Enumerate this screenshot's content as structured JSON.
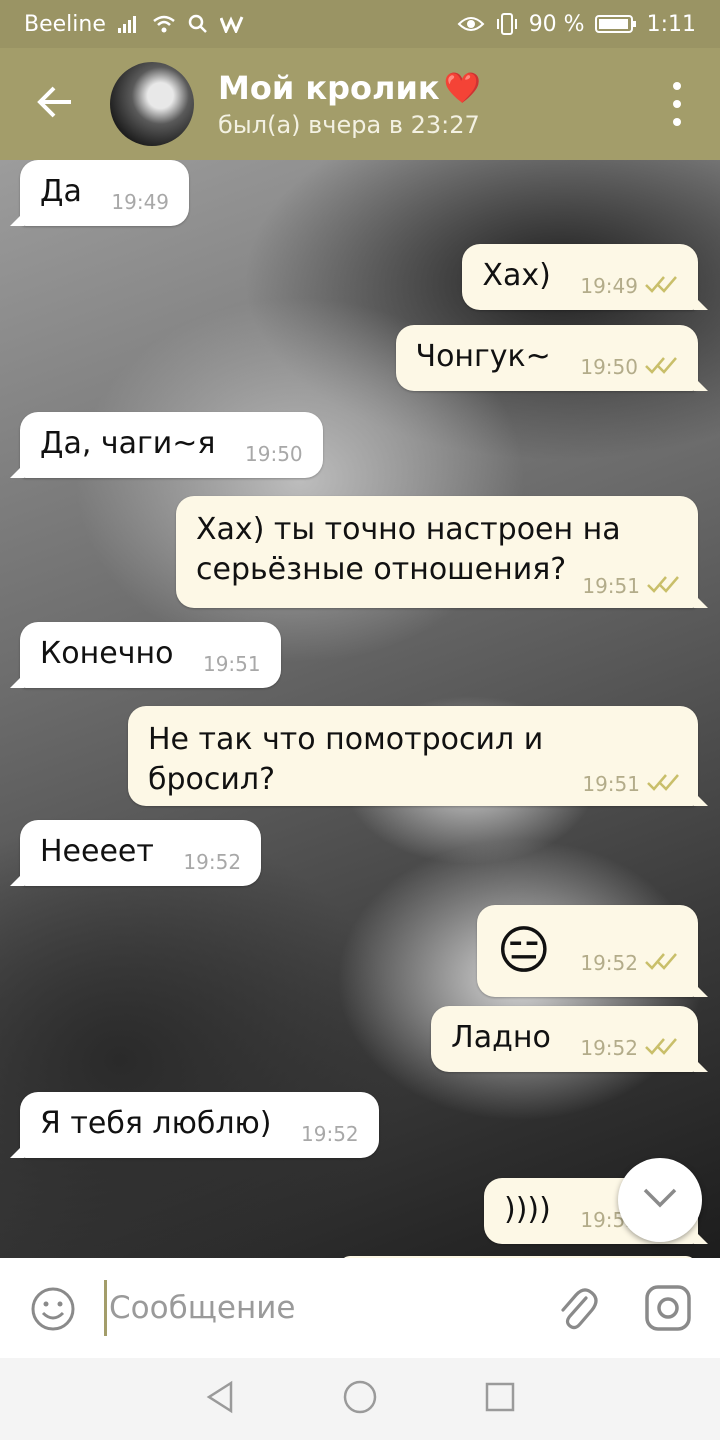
{
  "status_bar": {
    "carrier": "Beeline",
    "battery": "90 %",
    "time": "1:11"
  },
  "header": {
    "title": "Мой кролик",
    "title_emoji": "❤️",
    "status": "был(а) вчера в 23:27"
  },
  "messages": [
    {
      "dir": "in",
      "text": "Да",
      "time": "19:49"
    },
    {
      "dir": "out",
      "text": "Хах)",
      "time": "19:49",
      "read": true
    },
    {
      "dir": "out",
      "text": "Чонгук~",
      "time": "19:50",
      "read": true
    },
    {
      "dir": "in",
      "text": "Да, чаги~я",
      "time": "19:50"
    },
    {
      "dir": "out",
      "text": "Хах) ты точно настроен на серьёзные отношения?",
      "time": "19:51",
      "read": true
    },
    {
      "dir": "in",
      "text": "Конечно",
      "time": "19:51"
    },
    {
      "dir": "out",
      "text": "Не так что помотросил и бросил?",
      "time": "19:51",
      "read": true
    },
    {
      "dir": "in",
      "text": "Неееет",
      "time": "19:52"
    },
    {
      "dir": "out",
      "text": "😑",
      "time": "19:52",
      "read": true
    },
    {
      "dir": "out",
      "text": "Ладно",
      "time": "19:52",
      "read": true
    },
    {
      "dir": "in",
      "text": "Я тебя люблю)",
      "time": "19:52"
    },
    {
      "dir": "out",
      "text": "))))",
      "time": "19:52",
      "read": true
    }
  ],
  "composer": {
    "placeholder": "Сообщение"
  },
  "icons": {
    "back": "arrow-left-icon",
    "menu": "more-vertical-icon",
    "emoji": "smile-icon",
    "attach": "paperclip-icon",
    "camera": "instagram-camera-icon",
    "scroll": "chevron-down-icon",
    "read": "double-check-icon"
  },
  "colors": {
    "header": "#a39d6a",
    "status_bar": "#9a9464",
    "incoming_bubble": "#ffffff",
    "outgoing_bubble": "#fdf8e6",
    "check": "#c9bf6a"
  }
}
